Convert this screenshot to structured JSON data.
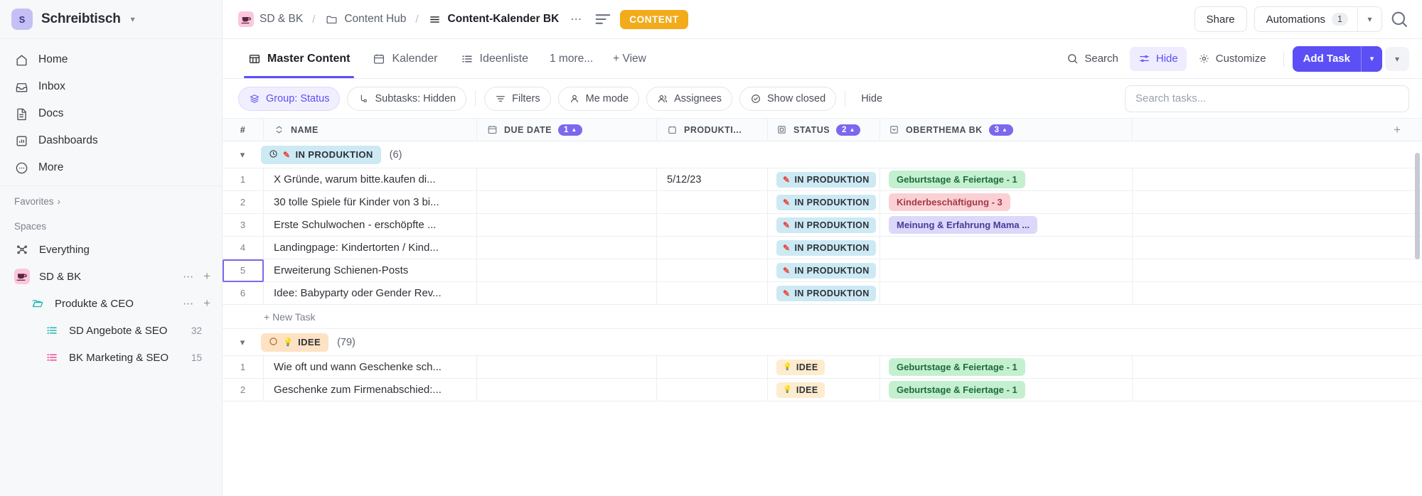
{
  "sidebar": {
    "workspace": {
      "initial": "S",
      "name": "Schreibtisch"
    },
    "nav": [
      {
        "label": "Home",
        "icon": "home-icon"
      },
      {
        "label": "Inbox",
        "icon": "inbox-icon"
      },
      {
        "label": "Docs",
        "icon": "docs-icon"
      },
      {
        "label": "Dashboards",
        "icon": "dashboard-icon"
      },
      {
        "label": "More",
        "icon": "more-icon"
      }
    ],
    "favorites_label": "Favorites",
    "spaces_label": "Spaces",
    "spaces": [
      {
        "label": "Everything",
        "icon": "everything-icon"
      },
      {
        "label": "SD & BK",
        "icon": "coffee-cup-icon"
      },
      {
        "label": "Produkte & CEO",
        "icon": "folder-icon"
      },
      {
        "label": "SD Angebote & SEO",
        "icon": "list-icon",
        "count": "32"
      },
      {
        "label": "BK Marketing & SEO",
        "icon": "list-icon",
        "count": "15"
      }
    ]
  },
  "topbar": {
    "breadcrumb": [
      {
        "label": "SD & BK",
        "icon": "coffee-cup-icon"
      },
      {
        "label": "Content Hub",
        "icon": "folder-icon"
      },
      {
        "label": "Content-Kalender BK",
        "icon": "list-icon"
      }
    ],
    "separator": "/",
    "more_icon": "ellipsis-icon",
    "description_icon": "description-icon",
    "content_badge": "CONTENT",
    "share_label": "Share",
    "automations_label": "Automations",
    "automations_count": "1",
    "search_icon": "search-icon"
  },
  "viewbar": {
    "tabs": [
      {
        "label": "Master Content",
        "icon": "table-icon",
        "active": true
      },
      {
        "label": "Kalender",
        "icon": "calendar-icon",
        "active": false
      },
      {
        "label": "Ideenliste",
        "icon": "list-icon",
        "active": false
      }
    ],
    "more_views": "1 more...",
    "add_view": "+ View",
    "search_label": "Search",
    "hide_label": "Hide",
    "customize_label": "Customize",
    "add_task_label": "Add Task"
  },
  "filterbar": {
    "chips": [
      {
        "label": "Group: Status",
        "icon": "layers-icon",
        "active": true
      },
      {
        "label": "Subtasks: Hidden",
        "icon": "subtask-icon",
        "active": false
      },
      {
        "label": "Filters",
        "icon": "filter-icon",
        "active": false
      },
      {
        "label": "Me mode",
        "icon": "person-icon",
        "active": false
      },
      {
        "label": "Assignees",
        "icon": "people-icon",
        "active": false
      },
      {
        "label": "Show closed",
        "icon": "check-circle-icon",
        "active": false
      }
    ],
    "hide_label": "Hide",
    "search_placeholder": "Search tasks...",
    "search_value": ""
  },
  "table": {
    "columns": [
      {
        "label": "#",
        "icon": ""
      },
      {
        "label": "NAME",
        "icon": "sort-icon"
      },
      {
        "label": "DUE DATE",
        "icon": "calendar-icon",
        "badge": "1",
        "badge_arrow": "▲"
      },
      {
        "label": "PRODUKTI...",
        "icon": "date-icon"
      },
      {
        "label": "STATUS",
        "icon": "status-icon",
        "badge": "2",
        "badge_arrow": "▲"
      },
      {
        "label": "OBERTHEMA BK",
        "icon": "dropdown-icon",
        "badge": "3",
        "badge_arrow": "▲"
      }
    ],
    "add_column": "+",
    "new_task_label": "+ New Task",
    "groups": [
      {
        "name": "IN PRODUKTION",
        "count": "(6)",
        "color_bg": "#cce9f4",
        "color_text": "#2e3138",
        "status_icon": "clock-icon",
        "rows": [
          {
            "num": "1",
            "name": "X Gründe, warum bitte.kaufen di...",
            "due": "",
            "prod": "5/12/23",
            "status": "IN PRODUKTION",
            "ober": "Geburtstage & Feiertage - 1",
            "ober_bg": "#c4f0d0",
            "ober_text": "#1d6b3c"
          },
          {
            "num": "2",
            "name": "30 tolle Spiele für Kinder von 3 bi...",
            "due": "",
            "prod": "",
            "status": "IN PRODUKTION",
            "ober": "Kinderbeschäftigung - 3",
            "ober_bg": "#fbd0d4",
            "ober_text": "#a33a4a"
          },
          {
            "num": "3",
            "name": "Erste Schulwochen - erschöpfte ...",
            "due": "",
            "prod": "",
            "status": "IN PRODUKTION",
            "ober": "Meinung & Erfahrung Mama ...",
            "ober_bg": "#dcd8fb",
            "ober_text": "#473c96"
          },
          {
            "num": "4",
            "name": "Landingpage: Kindertorten / Kind...",
            "due": "",
            "prod": "",
            "status": "IN PRODUKTION",
            "ober": "",
            "ober_bg": "",
            "ober_text": ""
          },
          {
            "num": "5",
            "name": "Erweiterung Schienen-Posts",
            "due": "",
            "prod": "",
            "status": "IN PRODUKTION",
            "ober": "",
            "ober_bg": "",
            "ober_text": "",
            "selected": true
          },
          {
            "num": "6",
            "name": "Idee: Babyparty oder Gender Rev...",
            "due": "",
            "prod": "",
            "status": "IN PRODUKTION",
            "ober": "",
            "ober_bg": "",
            "ober_text": ""
          }
        ]
      },
      {
        "name": "IDEE",
        "count": "(79)",
        "color_bg": "#fde2c4",
        "color_text": "#2e3138",
        "status_icon": "circle-icon",
        "rows": [
          {
            "num": "1",
            "name": "Wie oft und wann Geschenke sch...",
            "due": "",
            "prod": "",
            "status": "IDEE",
            "ober": "Geburtstage & Feiertage - 1",
            "ober_bg": "#c4f0d0",
            "ober_text": "#1d6b3c"
          },
          {
            "num": "2",
            "name": "Geschenke zum Firmenabschied:...",
            "due": "",
            "prod": "",
            "status": "IDEE",
            "ober": "Geburtstage & Feiertage - 1",
            "ober_bg": "#c4f0d0",
            "ober_text": "#1d6b3c"
          }
        ]
      }
    ],
    "status_styles": {
      "IN PRODUKTION": {
        "bg": "#cce9f4",
        "text": "#2e3138",
        "glyph": "✏"
      },
      "IDEE": {
        "bg": "#fdeccd",
        "text": "#2e3138",
        "glyph": "💡"
      }
    }
  }
}
